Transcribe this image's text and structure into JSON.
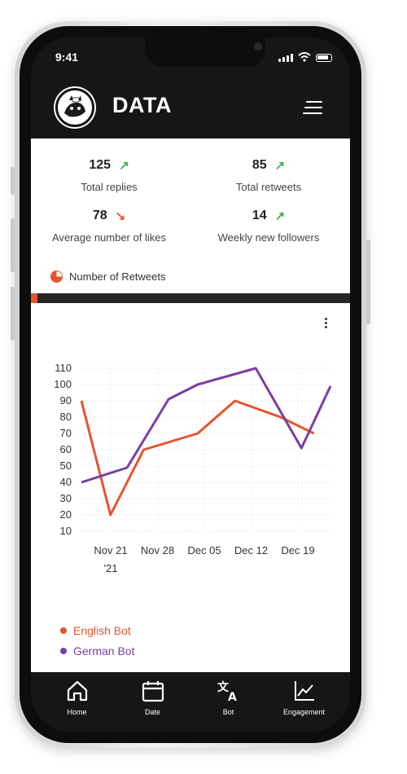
{
  "status_bar": {
    "time": "9:41"
  },
  "header": {
    "title": "DATA"
  },
  "stats": [
    {
      "value": "125",
      "label": "Total replies",
      "trend": "up",
      "color": "#4caf50"
    },
    {
      "value": "85",
      "label": "Total retweets",
      "trend": "up",
      "color": "#4caf50"
    },
    {
      "value": "78",
      "label": "Average number of likes",
      "trend": "down",
      "color": "#e4552d"
    },
    {
      "value": "14",
      "label": "Weekly new followers",
      "trend": "up",
      "color": "#4caf50"
    }
  ],
  "section": {
    "title": "Number of Retweets"
  },
  "colors": {
    "accent": "#e4552d",
    "english": "#e4552d",
    "german": "#7b3fa0",
    "dark": "#161616"
  },
  "chart_data": {
    "type": "line",
    "x": [
      "Nov 21 '21",
      "Nov 28",
      "Dec 05",
      "Dec 12",
      "Dec 19",
      ""
    ],
    "x_ticks": [
      "Nov 21",
      "Nov 28",
      "Dec 05",
      "Dec 12",
      "Dec 19"
    ],
    "x_subtick": "'21",
    "y_ticks": [
      10,
      20,
      30,
      40,
      50,
      60,
      70,
      80,
      90,
      100,
      110
    ],
    "ylim": [
      10,
      110
    ],
    "grid": true,
    "legend_position": "bottom-left",
    "series": [
      {
        "name": "English Bot",
        "color": "#e4552d",
        "x_days": [
          0,
          3.5,
          7.5,
          14,
          18.5,
          24,
          28
        ],
        "values": [
          90,
          20,
          60,
          70,
          90,
          80,
          70
        ]
      },
      {
        "name": "German Bot",
        "color": "#7b3fa0",
        "x_days": [
          0,
          5.5,
          10.5,
          14,
          21,
          26.5,
          30
        ],
        "values": [
          40,
          49,
          91,
          100,
          110,
          61,
          99
        ]
      }
    ],
    "x_domain": [
      0,
      30
    ]
  },
  "nav": [
    {
      "label": "Home",
      "icon": "home-icon"
    },
    {
      "label": "Date",
      "icon": "calendar-icon"
    },
    {
      "label": "Bot",
      "icon": "translate-icon"
    },
    {
      "label": "Engagement",
      "icon": "chart-icon"
    }
  ]
}
